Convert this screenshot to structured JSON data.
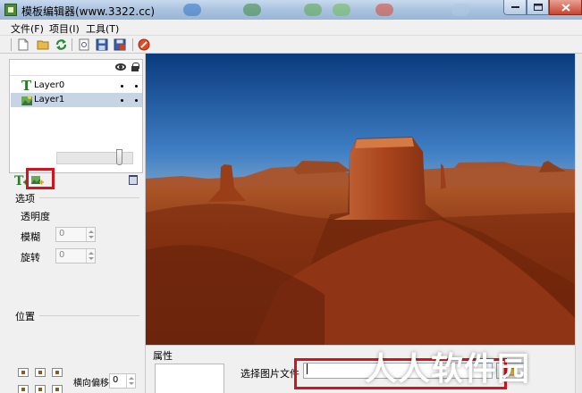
{
  "window": {
    "title": "模板编辑器(www.3322.cc)",
    "controls": [
      "minimize",
      "maximize",
      "close"
    ]
  },
  "menu": {
    "items": [
      "文件(F)",
      "项目(I)",
      "工具(T)"
    ]
  },
  "toolbar": {
    "icons": [
      "new-file-icon",
      "open-folder-icon",
      "refresh-icon",
      "preview-icon",
      "save-icon",
      "save-as-icon",
      "stop-icon"
    ]
  },
  "layers": {
    "rows": [
      {
        "name": "Layer0",
        "type": "text",
        "selected": false
      },
      {
        "name": "Layer1",
        "type": "image",
        "selected": true
      }
    ]
  },
  "options": {
    "title": "选项",
    "opacity_label": "透明度",
    "opacity_level": 0.85,
    "blur_label": "模糊",
    "blur_value": "0",
    "rotate_label": "旋转",
    "rotate_value": "0"
  },
  "position": {
    "title": "位置",
    "h_offset_label": "横向偏移",
    "h_offset_value": "0"
  },
  "properties": {
    "title": "属性",
    "choose_image_label": "选择图片文件",
    "file_value": ""
  },
  "watermark": "人人软件园",
  "colors": {
    "highlight": "#d2141c",
    "selection": "#c7d4e4",
    "titlebar": "#a9c2df"
  }
}
